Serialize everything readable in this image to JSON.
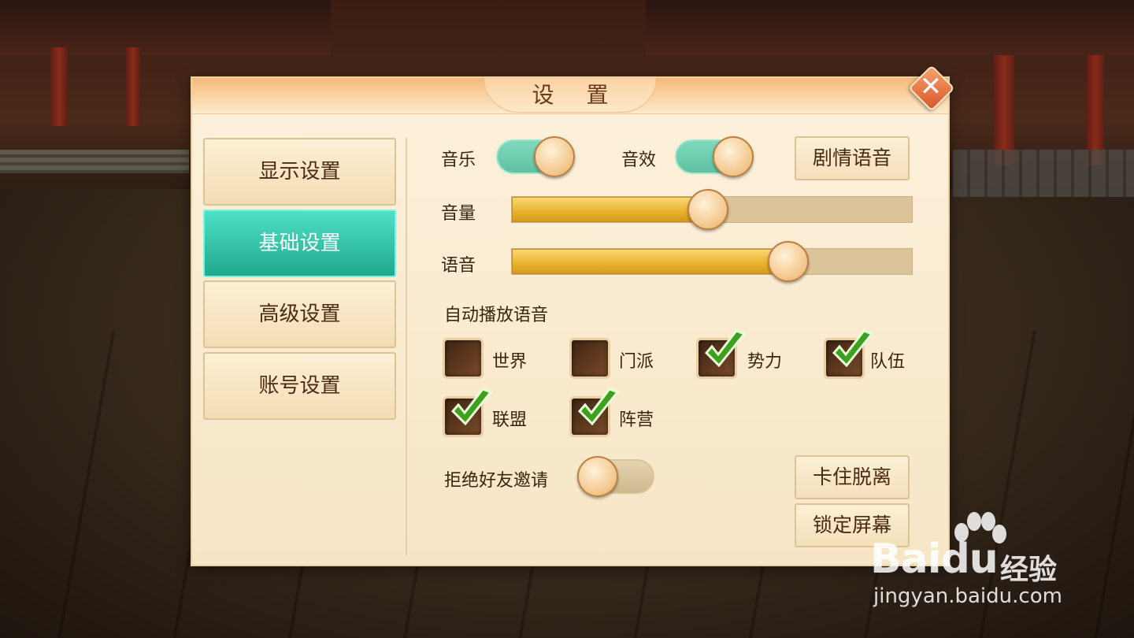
{
  "dialog": {
    "title": "设 置",
    "close_glyph": "✕"
  },
  "tabs": [
    {
      "label": "显示设置",
      "active": false
    },
    {
      "label": "基础设置",
      "active": true
    },
    {
      "label": "高级设置",
      "active": false
    },
    {
      "label": "账号设置",
      "active": false
    }
  ],
  "basic": {
    "music_label": "音乐",
    "music_on": true,
    "sfx_label": "音效",
    "sfx_on": true,
    "story_voice_button": "剧情语音",
    "volume_label": "音量",
    "volume_level": 0.49,
    "voice_label": "语音",
    "voice_level": 0.69,
    "auto_play_title": "自动播放语音",
    "channels": [
      {
        "label": "世界",
        "checked": false
      },
      {
        "label": "门派",
        "checked": false
      },
      {
        "label": "势力",
        "checked": true
      },
      {
        "label": "队伍",
        "checked": true
      },
      {
        "label": "联盟",
        "checked": true
      },
      {
        "label": "阵营",
        "checked": true
      }
    ],
    "reject_friend_label": "拒绝好友邀请",
    "reject_friend_on": false,
    "unstuck_button": "卡住脱离",
    "lock_screen_button": "锁定屏幕"
  },
  "watermark": {
    "brand": "Bai",
    "brand_suffix": "du",
    "cn": "经验",
    "url": "jingyan.baidu.com"
  },
  "colors": {
    "active_tab": "#1fa98f",
    "toggle_on": "#6fcdb0",
    "slider_fill": "#e9b12c",
    "check": "#3ea01f",
    "close": "#d8572a"
  }
}
